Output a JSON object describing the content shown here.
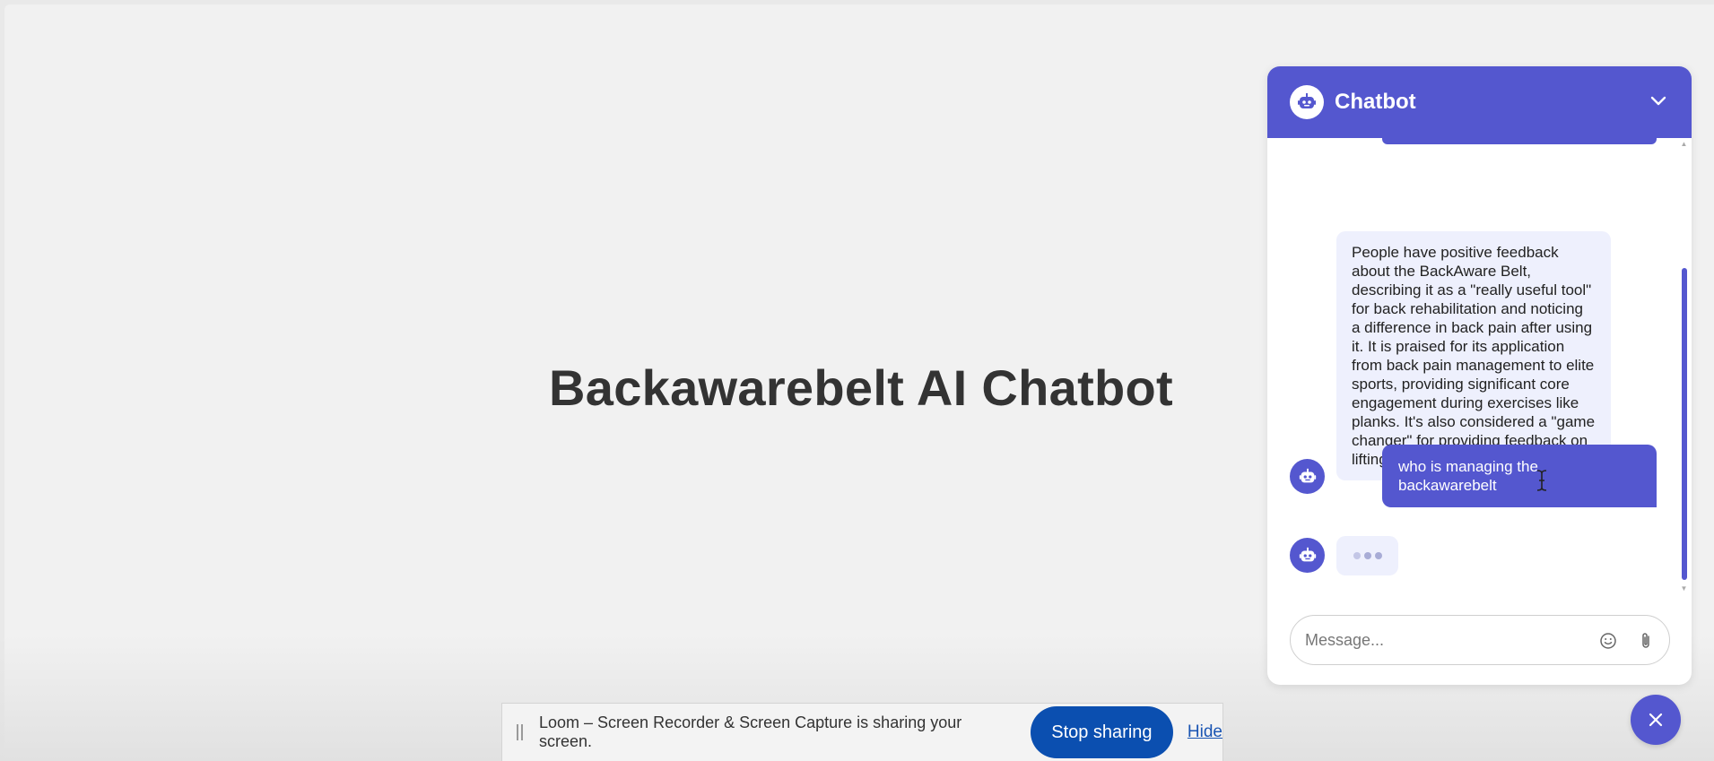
{
  "page": {
    "title": "Backawarebelt AI Chatbot"
  },
  "chat": {
    "title": "Chatbot",
    "messages": {
      "bot_reply": "People have positive feedback about the BackAware Belt, describing it as a \"really useful tool\" for back rehabilitation and noticing a difference in back pain after using it. It is praised for its application from back pain management to elite sports, providing significant core engagement during exercises like planks. It's also considered a \"game changer\" for providing feedback on lifting techniques.",
      "user_message": "who is managing the backawarebelt"
    },
    "input": {
      "placeholder": "Message...",
      "value": ""
    },
    "colors": {
      "accent": "#5457cf",
      "bot_bubble": "#eef0fd"
    }
  },
  "share_bar": {
    "text": "Loom – Screen Recorder & Screen Capture is sharing your screen.",
    "stop_label": "Stop sharing",
    "hide_label": "Hide",
    "stop_color": "#0b4fb0"
  },
  "icons": {
    "header_avatar": "robot-icon",
    "collapse": "chevron-down-icon",
    "bot_avatar": "robot-icon",
    "emoji": "smiley-icon",
    "attach": "paperclip-icon",
    "close": "close-icon",
    "cursor": "text-cursor-icon"
  }
}
